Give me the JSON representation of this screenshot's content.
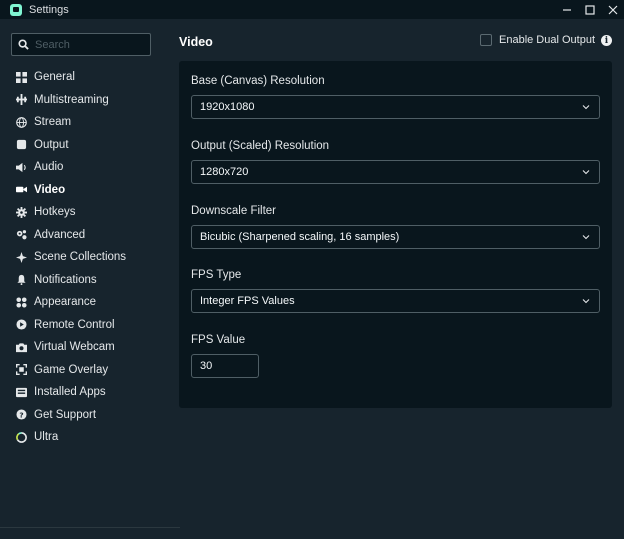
{
  "window": {
    "title": "Settings",
    "controls": [
      "minimize-icon",
      "maximize-icon",
      "close-icon"
    ]
  },
  "sidebar": {
    "search_placeholder": "Search",
    "items": [
      {
        "label": "General",
        "icon": "grid-icon"
      },
      {
        "label": "Multistreaming",
        "icon": "multistream-icon"
      },
      {
        "label": "Stream",
        "icon": "globe-icon"
      },
      {
        "label": "Output",
        "icon": "output-icon"
      },
      {
        "label": "Audio",
        "icon": "speaker-icon"
      },
      {
        "label": "Video",
        "icon": "camera-icon",
        "active": true
      },
      {
        "label": "Hotkeys",
        "icon": "gear-icon"
      },
      {
        "label": "Advanced",
        "icon": "gears-icon"
      },
      {
        "label": "Scene Collections",
        "icon": "collections-icon"
      },
      {
        "label": "Notifications",
        "icon": "bell-icon"
      },
      {
        "label": "Appearance",
        "icon": "palette-icon"
      },
      {
        "label": "Remote Control",
        "icon": "remote-icon"
      },
      {
        "label": "Virtual Webcam",
        "icon": "webcam-icon"
      },
      {
        "label": "Game Overlay",
        "icon": "overlay-icon"
      },
      {
        "label": "Installed Apps",
        "icon": "apps-icon"
      },
      {
        "label": "Get Support",
        "icon": "help-icon"
      },
      {
        "label": "Ultra",
        "icon": "ultra-icon"
      }
    ]
  },
  "main": {
    "title": "Video",
    "dual_output_label": "Enable Dual Output",
    "dual_output_checked": false,
    "fields": {
      "base_resolution": {
        "label": "Base (Canvas) Resolution",
        "value": "1920x1080"
      },
      "output_resolution": {
        "label": "Output (Scaled) Resolution",
        "value": "1280x720"
      },
      "downscale_filter": {
        "label": "Downscale Filter",
        "value": "Bicubic (Sharpened scaling, 16 samples)"
      },
      "fps_type": {
        "label": "FPS Type",
        "value": "Integer FPS Values"
      },
      "fps_value": {
        "label": "FPS Value",
        "value": "30"
      }
    }
  },
  "colors": {
    "background": "#17242d",
    "panel": "#09161d",
    "border": "#4f5e65",
    "accent": "#80f5d2",
    "text": "#f5f8fa"
  }
}
